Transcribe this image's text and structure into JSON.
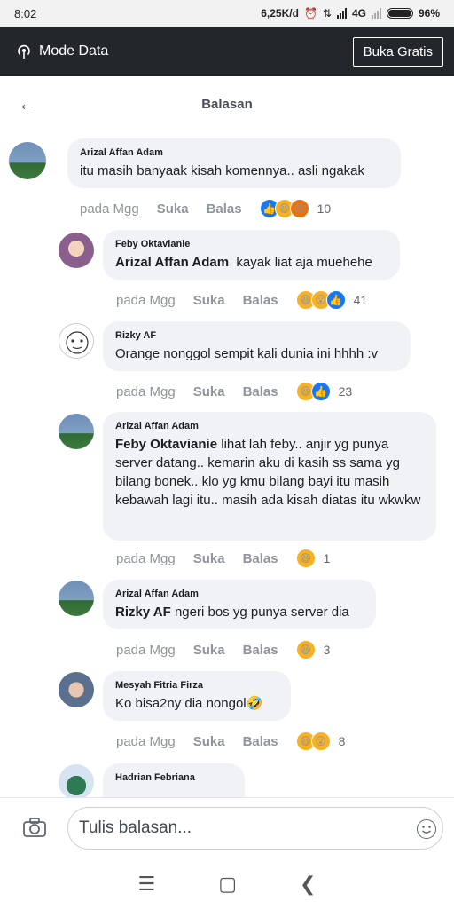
{
  "status": {
    "time": "8:02",
    "speed": "6,25K/d",
    "network": "4G",
    "battery": "96%"
  },
  "databar": {
    "label": "Mode Data",
    "button": "Buka Gratis"
  },
  "header": {
    "title": "Balasan"
  },
  "comments": [
    {
      "name": "Arizal Affan Adam",
      "mention": "",
      "text": "itu masih banyaak kisah komennya.. asli ngakak",
      "time": "pada Mgg",
      "like": "Suka",
      "reply": "Balas",
      "count": "10",
      "reactions": [
        "like-icon",
        "haha-icon",
        "angry-icon"
      ]
    },
    {
      "name": "Feby Oktavianie",
      "mention": "Arizal Affan Adam",
      "text": "kayak liat aja muehehe",
      "time": "pada Mgg",
      "like": "Suka",
      "reply": "Balas",
      "count": "41",
      "reactions": [
        "haha-icon",
        "wow-icon",
        "like-icon"
      ]
    },
    {
      "name": "Rizky AF",
      "mention": "",
      "text": "Orange nonggol sempit kali dunia ini hhhh :v",
      "time": "pada Mgg",
      "like": "Suka",
      "reply": "Balas",
      "count": "23",
      "reactions": [
        "haha-icon",
        "like-icon"
      ]
    },
    {
      "name": "Arizal Affan Adam",
      "mention": "Feby Oktavianie",
      "text": "lihat lah feby.. anjir yg punya server datang.. kemarin aku di kasih ss sama yg bilang bonek.. klo yg kmu bilang bayi itu masih kebawah lagi itu.. masih ada kisah diatas itu wkwkw",
      "time": "pada Mgg",
      "like": "Suka",
      "reply": "Balas",
      "count": "1",
      "reactions": [
        "haha-icon"
      ]
    },
    {
      "name": "Arizal Affan Adam",
      "mention": "Rizky AF",
      "text": "ngeri bos yg punya server dia",
      "time": "pada Mgg",
      "like": "Suka",
      "reply": "Balas",
      "count": "3",
      "reactions": [
        "haha-icon"
      ]
    },
    {
      "name": "Mesyah Fitria Firza",
      "mention": "",
      "text": "Ko bisa2ny dia nongol🤣",
      "time": "pada Mgg",
      "like": "Suka",
      "reply": "Balas",
      "count": "8",
      "reactions": [
        "haha-icon",
        "wow-icon"
      ]
    },
    {
      "name": "Hadrian Febriana"
    }
  ],
  "compose": {
    "placeholder": "Tulis balasan..."
  },
  "colors": {
    "accent": "#1877f2",
    "bubble": "#f0f2f5",
    "topbar": "#23262b"
  }
}
